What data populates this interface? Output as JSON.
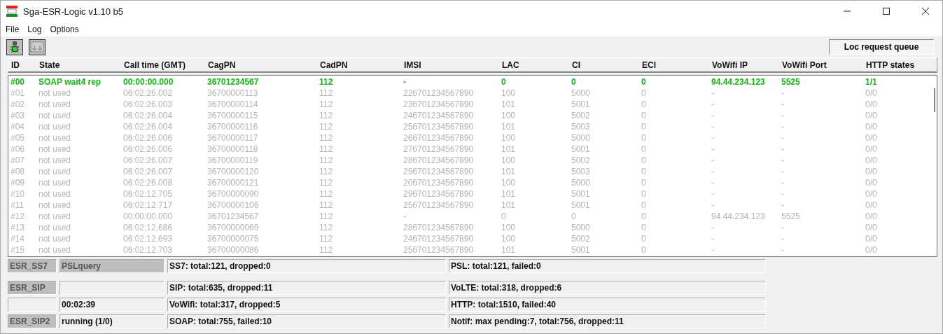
{
  "window": {
    "title": "Sga-ESR-Logic  v1.10 b5"
  },
  "menu": [
    "File",
    "Log",
    "Options"
  ],
  "toolbar": {
    "queue_button": "Loc request queue"
  },
  "table": {
    "columns": [
      "ID",
      "State",
      "Call time (GMT)",
      "CagPN",
      "CadPN",
      "IMSI",
      "LAC",
      "CI",
      "ECI",
      "VoWifi IP",
      "VoWifi Port",
      "HTTP states"
    ],
    "rows": [
      {
        "active": true,
        "cells": [
          "#00",
          "SOAP wait4 rep",
          "00:00:00.000",
          "36701234567",
          "112",
          "-",
          "0",
          "0",
          "0",
          "94.44.234.123",
          "5525",
          "1/1"
        ]
      },
      {
        "active": false,
        "cells": [
          "#01",
          "not used",
          "06:02:26.002",
          "36700000113",
          "112",
          "226701234567890",
          "100",
          "5000",
          "0",
          "-",
          "-",
          "0/0"
        ]
      },
      {
        "active": false,
        "cells": [
          "#02",
          "not used",
          "06:02:26.003",
          "36700000114",
          "112",
          "236701234567890",
          "101",
          "5001",
          "0",
          "-",
          "-",
          "0/0"
        ]
      },
      {
        "active": false,
        "cells": [
          "#03",
          "not used",
          "06:02:26.004",
          "36700000115",
          "112",
          "246701234567890",
          "100",
          "5002",
          "0",
          "-",
          "-",
          "0/0"
        ]
      },
      {
        "active": false,
        "cells": [
          "#04",
          "not used",
          "06:02:26.004",
          "36700000116",
          "112",
          "256701234567890",
          "101",
          "5003",
          "0",
          "-",
          "-",
          "0/0"
        ]
      },
      {
        "active": false,
        "cells": [
          "#05",
          "not used",
          "06:02:26.006",
          "36700000117",
          "112",
          "266701234567890",
          "100",
          "5000",
          "0",
          "-",
          "-",
          "0/0"
        ]
      },
      {
        "active": false,
        "cells": [
          "#06",
          "not used",
          "06:02:26.006",
          "36700000118",
          "112",
          "276701234567890",
          "101",
          "5001",
          "0",
          "-",
          "-",
          "0/0"
        ]
      },
      {
        "active": false,
        "cells": [
          "#07",
          "not used",
          "06:02:26.007",
          "36700000119",
          "112",
          "286701234567890",
          "100",
          "5002",
          "0",
          "-",
          "-",
          "0/0"
        ]
      },
      {
        "active": false,
        "cells": [
          "#08",
          "not used",
          "06:02:26.007",
          "36700000120",
          "112",
          "296701234567890",
          "101",
          "5003",
          "0",
          "-",
          "-",
          "0/0"
        ]
      },
      {
        "active": false,
        "cells": [
          "#09",
          "not used",
          "06:02:26.008",
          "36700000121",
          "112",
          "206701234567890",
          "100",
          "5000",
          "0",
          "-",
          "-",
          "0/0"
        ]
      },
      {
        "active": false,
        "cells": [
          "#10",
          "not used",
          "06:02:12.705",
          "36700000090",
          "112",
          "296701234567890",
          "101",
          "5001",
          "0",
          "-",
          "-",
          "0/0"
        ]
      },
      {
        "active": false,
        "cells": [
          "#11",
          "not used",
          "06:02:12.717",
          "36700000106",
          "112",
          "256701234567890",
          "101",
          "5001",
          "0",
          "-",
          "-",
          "0/0"
        ]
      },
      {
        "active": false,
        "cells": [
          "#12",
          "not used",
          "00:00:00.000",
          "36701234567",
          "112",
          "-",
          "0",
          "0",
          "0",
          "94.44.234.123",
          "5525",
          "0/0"
        ]
      },
      {
        "active": false,
        "cells": [
          "#13",
          "not used",
          "06:02:12.686",
          "36700000069",
          "112",
          "286701234567890",
          "100",
          "5000",
          "0",
          "-",
          "-",
          "0/0"
        ]
      },
      {
        "active": false,
        "cells": [
          "#14",
          "not used",
          "06:02:12.693",
          "36700000075",
          "112",
          "246701234567890",
          "100",
          "5002",
          "0",
          "-",
          "-",
          "0/0"
        ]
      },
      {
        "active": false,
        "cells": [
          "#15",
          "not used",
          "06:02:12.703",
          "36700000086",
          "112",
          "256701234567890",
          "101",
          "5001",
          "0",
          "-",
          "-",
          "0/0"
        ]
      }
    ]
  },
  "status_rows": [
    {
      "cells": [
        {
          "text": "ESR_SS7",
          "shaded": true
        },
        {
          "text": "PSLquery",
          "shaded": true
        },
        {
          "text": "SS7: total:121, dropped:0",
          "shaded": false
        },
        {
          "text": "PSL: total:121, failed:0",
          "shaded": false
        }
      ]
    },
    {
      "cells": [
        {
          "text": "ESR_SIP",
          "shaded": true
        },
        {
          "text": "",
          "shaded": false
        },
        {
          "text": "SIP: total:635, dropped:11",
          "shaded": false
        },
        {
          "text": "VoLTE: total:318, dropped:6",
          "shaded": false
        }
      ]
    },
    {
      "cells": [
        {
          "text": "",
          "shaded": false
        },
        {
          "text": "00:02:39",
          "shaded": false
        },
        {
          "text": "VoWifi: total:317, dropped:5",
          "shaded": false
        },
        {
          "text": "HTTP: total:1510, failed:40",
          "shaded": false
        }
      ]
    },
    {
      "cells": [
        {
          "text": "ESR_SIP2",
          "shaded": true
        },
        {
          "text": "running (1/0)",
          "shaded": false
        },
        {
          "text": "SOAP: total:755, failed:10",
          "shaded": false
        },
        {
          "text": "Notif: max pending:7, total:756, dropped:11",
          "shaded": false
        }
      ]
    }
  ]
}
